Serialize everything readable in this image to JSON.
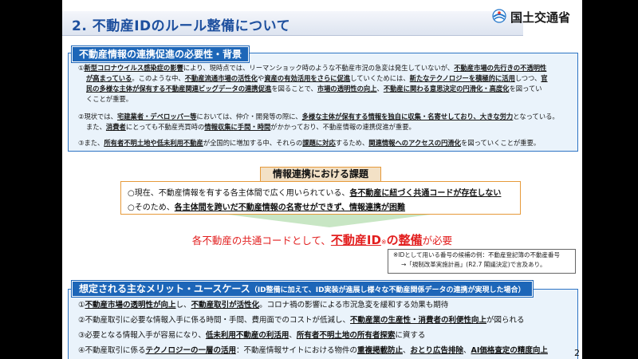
{
  "slide": {
    "title": "2. 不動産IDのルール整備について",
    "logo_text": "国土交通省",
    "page_number": "2"
  },
  "section1": {
    "header": "不動産情報の連携促進の必要性・背景",
    "p1": [
      {
        "t": "①",
        "b": false
      },
      {
        "t": "新型コロナウイルス感染症の影響",
        "b": true
      },
      {
        "t": "により、現時点では、リーマンショック時のような不動産市況の急変は発生していないが、",
        "b": false
      },
      {
        "t": "不動産市場の先行きの不透明性",
        "b": true
      }
    ],
    "p1b": [
      {
        "t": "が高まっている",
        "b": true
      },
      {
        "t": "。このような中、",
        "b": false
      },
      {
        "t": "不動産流通市場の活性化",
        "b": true
      },
      {
        "t": "や",
        "b": false
      },
      {
        "t": "資産の有効活用をさらに促進",
        "b": true
      },
      {
        "t": "していくためには、",
        "b": false
      },
      {
        "t": "新たなテクノロジーを積極的に活用",
        "b": true
      },
      {
        "t": "しつつ、",
        "b": false
      },
      {
        "t": "官",
        "b": true
      }
    ],
    "p1c": [
      {
        "t": "民の多様な主体が保有する不動産関連ビッグデータの連携促進",
        "b": true
      },
      {
        "t": "を図ることで、",
        "b": false
      },
      {
        "t": "市場の透明性の向上",
        "b": true
      },
      {
        "t": "、",
        "b": false
      },
      {
        "t": "不動産に関わる意思決定の円滑化・高度化",
        "b": true
      },
      {
        "t": "を図ってい",
        "b": false
      }
    ],
    "p1d": [
      {
        "t": "くことが重要。",
        "b": false
      }
    ],
    "p2": [
      {
        "t": "②現状では、",
        "b": false
      },
      {
        "t": "宅建業者・デベロッパー等",
        "b": true
      },
      {
        "t": "においては、仲介・開発等の際に、",
        "b": false
      },
      {
        "t": "多様な主体が保有する情報を独自に収集・名寄せしており、大きな労力",
        "b": true
      },
      {
        "t": "となっている。",
        "b": false
      }
    ],
    "p2b": [
      {
        "t": "また、",
        "b": false
      },
      {
        "t": "消費者",
        "b": true
      },
      {
        "t": "にとっても不動産売買時の",
        "b": false
      },
      {
        "t": "情報収集に手間・時間",
        "b": true
      },
      {
        "t": "がかかっており、不動産情報の連携促進が重要。",
        "b": false
      }
    ],
    "p3": [
      {
        "t": "③また、",
        "b": false
      },
      {
        "t": "所有者不明土地や低未利用不動産",
        "b": true
      },
      {
        "t": "が全国的に増加する中、それらの",
        "b": false
      },
      {
        "t": "課題に対応",
        "b": true
      },
      {
        "t": "するため、",
        "b": false
      },
      {
        "t": "関連情報へのアクセスの円滑化",
        "b": true
      },
      {
        "t": "を図っていくことが重要。",
        "b": false
      }
    ]
  },
  "issues": {
    "header": "情報連携における課題",
    "line1": [
      {
        "t": "○現在、不動産情報を有する各主体間で広く用いられている、",
        "b": false
      },
      {
        "t": "各不動産に紐づく共通コードが存在しない",
        "b": true
      }
    ],
    "line2": [
      {
        "t": "○そのため、",
        "b": false
      },
      {
        "t": "各主体間を跨いだ不動産情報の名寄せができず、情報連携が困難",
        "b": true
      }
    ]
  },
  "conclusion": {
    "pre": "各不動産の共通コードとして、",
    "big": "不動産ID",
    "sup": "※",
    "mid": "の",
    "big2": "整備",
    "post": "が必要"
  },
  "note": {
    "line1": "※IDとして用いる番号の候補の例：不動産登記簿の不動産番号",
    "line2": "→「規制改革実施計画」(R2.7 閣議決定)で言及あり。"
  },
  "section2": {
    "header": "想定される主なメリット・ユースケース",
    "header_sub": "（ID整備に加えて、ID実装が進展し様々な不動産関係データの連携が実現した場合）",
    "m1": [
      {
        "t": "①",
        "b": false
      },
      {
        "t": "不動産市場の透明性が向上",
        "b": true
      },
      {
        "t": "し、",
        "b": false
      },
      {
        "t": "不動産取引が活性化",
        "b": true
      },
      {
        "t": "。コロナ禍の影響による市況急変を緩和する効果も期待",
        "b": false
      }
    ],
    "m2": [
      {
        "t": "②不動産取引に必要な情報入手に係る時間・手間、費用面でのコストが低減し、",
        "b": false
      },
      {
        "t": "不動産業の生産性・消費者の利便性向上",
        "b": true
      },
      {
        "t": "が図られる",
        "b": false
      }
    ],
    "m3": [
      {
        "t": "③必要となる情報入手が容易になり、",
        "b": false
      },
      {
        "t": "低未利用不動産の利活用",
        "b": true
      },
      {
        "t": "、",
        "b": false
      },
      {
        "t": "所有者不明土地の所有者探索",
        "b": true
      },
      {
        "t": "に資する",
        "b": false
      }
    ],
    "m4": [
      {
        "t": "④不動産取引に係る",
        "b": false
      },
      {
        "t": "テクノロジーの一層の活用",
        "b": true
      },
      {
        "t": "：不動産情報サイトにおける物件の",
        "b": false
      },
      {
        "t": "重複掲載防止",
        "b": true
      },
      {
        "t": "、",
        "b": false
      },
      {
        "t": "おとり広告排除",
        "b": true
      },
      {
        "t": "、",
        "b": false
      },
      {
        "t": "AI価格査定の精度向上",
        "b": true
      }
    ]
  },
  "colors": {
    "title": "#1d4f9e",
    "section_header": "#1d66b8",
    "issue_border": "#e69a3a",
    "conclusion": "#e21f1f"
  }
}
